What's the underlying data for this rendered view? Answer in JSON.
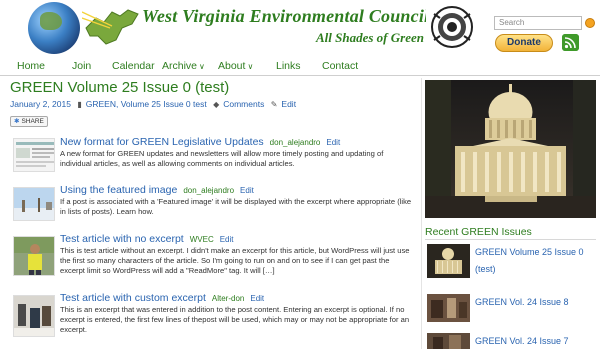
{
  "header": {
    "site_title": "West Virginia Environmental Council",
    "tagline": "All Shades of Green",
    "search_placeholder": "Search",
    "donate_label": "Donate"
  },
  "nav": {
    "items": [
      "Home",
      "Join",
      "Calendar",
      "Archive",
      "About",
      "Links",
      "Contact"
    ]
  },
  "post": {
    "title": "GREEN Volume 25 Issue 0 (test)",
    "date": "January 2, 2015",
    "categories": "GREEN, Volume 25 Issue 0 test",
    "comments": "Comments",
    "edit": "Edit",
    "share": "SHARE"
  },
  "articles": [
    {
      "title": "New format for GREEN Legislative Updates",
      "author": "don_alejandro",
      "edit": "Edit",
      "excerpt": "A new format for GREEN updates and newsletters will allow more timely posting and updating of individual articles, as well as allowing comments on individual articles."
    },
    {
      "title": "Using the featured image",
      "author": "don_alejandro",
      "edit": "Edit",
      "excerpt": "If a post is associated with a 'Featured image' it will be displayed with the excerpt where appropriate (like in lists of posts). Learn how."
    },
    {
      "title": "Test article with no excerpt",
      "author": "WVEC",
      "edit": "Edit",
      "excerpt": "This is test article without an excerpt. I didn't make an excerpt for this article, but WordPress will just use the first so many characters of the article.  So I'm going to run on and on to see if I can get past the excerpt limit so WordPress will add a \"ReadMore\" tag. It will […]"
    },
    {
      "title": "Test article with custom excerpt",
      "author": "Alter-don",
      "edit": "Edit",
      "excerpt": "This is an excerpt that was entered in addition to the post content. Entering an excerpt is optional. If no excerpt is entered, the first few lines of thepost will be used, which may or may not be appropriate for an excerpt."
    }
  ],
  "sidebar": {
    "heading": "Recent GREEN Issues",
    "issues": [
      "GREEN Volume 25 Issue 0 (test)",
      "GREEN Vol. 24 Issue 8",
      "GREEN Vol. 24 Issue 7"
    ]
  },
  "colors": {
    "brand_green": "#2e7d1f",
    "link_blue": "#2a64b0",
    "donate_gold": "#f2b339"
  },
  "icons": [
    "globe-logo",
    "wv-state-logo",
    "seal-logo",
    "search-icon",
    "rss-icon",
    "folder-icon",
    "comment-icon",
    "edit-icon",
    "share-icon"
  ]
}
